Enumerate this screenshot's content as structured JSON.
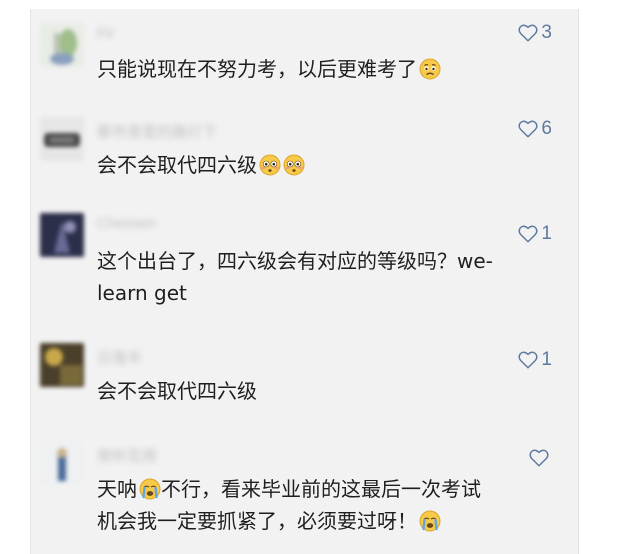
{
  "comments": [
    {
      "username": "Fir",
      "likes": "3",
      "text": "只能说现在不努力考，以后更难考了",
      "emoji": "worried-face-emoji"
    },
    {
      "username": "都市夜里的路灯下",
      "likes": "6",
      "text": "会不会取代四六级",
      "emoji": "flushed-face-emoji"
    },
    {
      "username": "Chessen",
      "likes": "1",
      "text_line1": "这个出台了，四六级会有对应的等级吗？we-",
      "text_line2": "learn get"
    },
    {
      "username": "日落半",
      "likes": "1",
      "text": "会不会取代四六级"
    },
    {
      "username": "夜听花雨",
      "likes": "",
      "text_part1": "天呐",
      "text_part2": "不行，看来毕业前的这最后一次考试",
      "text_line2": "机会我一定要抓紧了，必须要过呀！",
      "emoji": "crying-face-emoji"
    }
  ],
  "colors": {
    "panel_bg": "#f2f2f2",
    "text": "#1f1f1f",
    "like_blue": "#5f7aa0",
    "username_gray": "#c0c0c0"
  },
  "icons": {
    "like": "heart-outline-icon"
  }
}
